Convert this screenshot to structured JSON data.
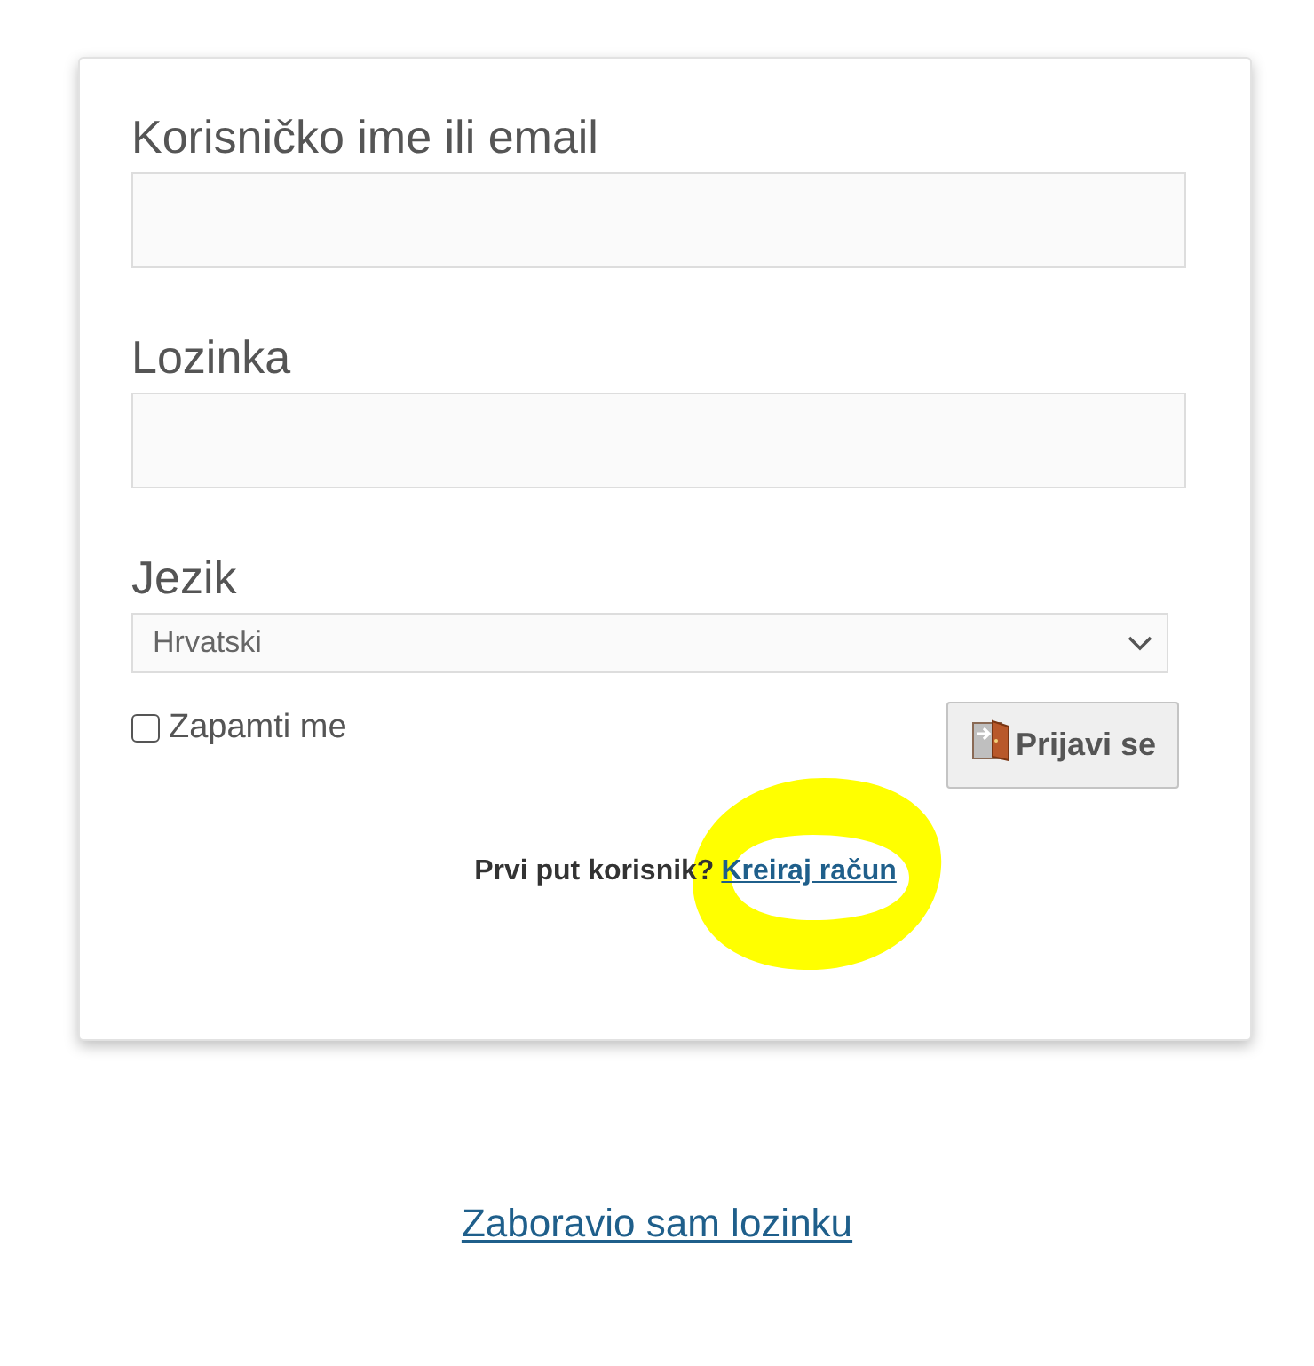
{
  "fields": [
    {
      "label": "Korisničko ime ili email"
    },
    {
      "label": "Lozinka"
    }
  ],
  "language": {
    "label": "Jezik",
    "value": "Hrvatski"
  },
  "remember": {
    "label": "Zapamti me",
    "checked": false
  },
  "login_button": {
    "label": "Prijavi se"
  },
  "signup": {
    "prompt": "Prvi put korisnik?",
    "link": "Kreiraj račun"
  },
  "annotation": {
    "kind": "scribble"
  },
  "forgot_link": "Zaboravio sam lozinku"
}
